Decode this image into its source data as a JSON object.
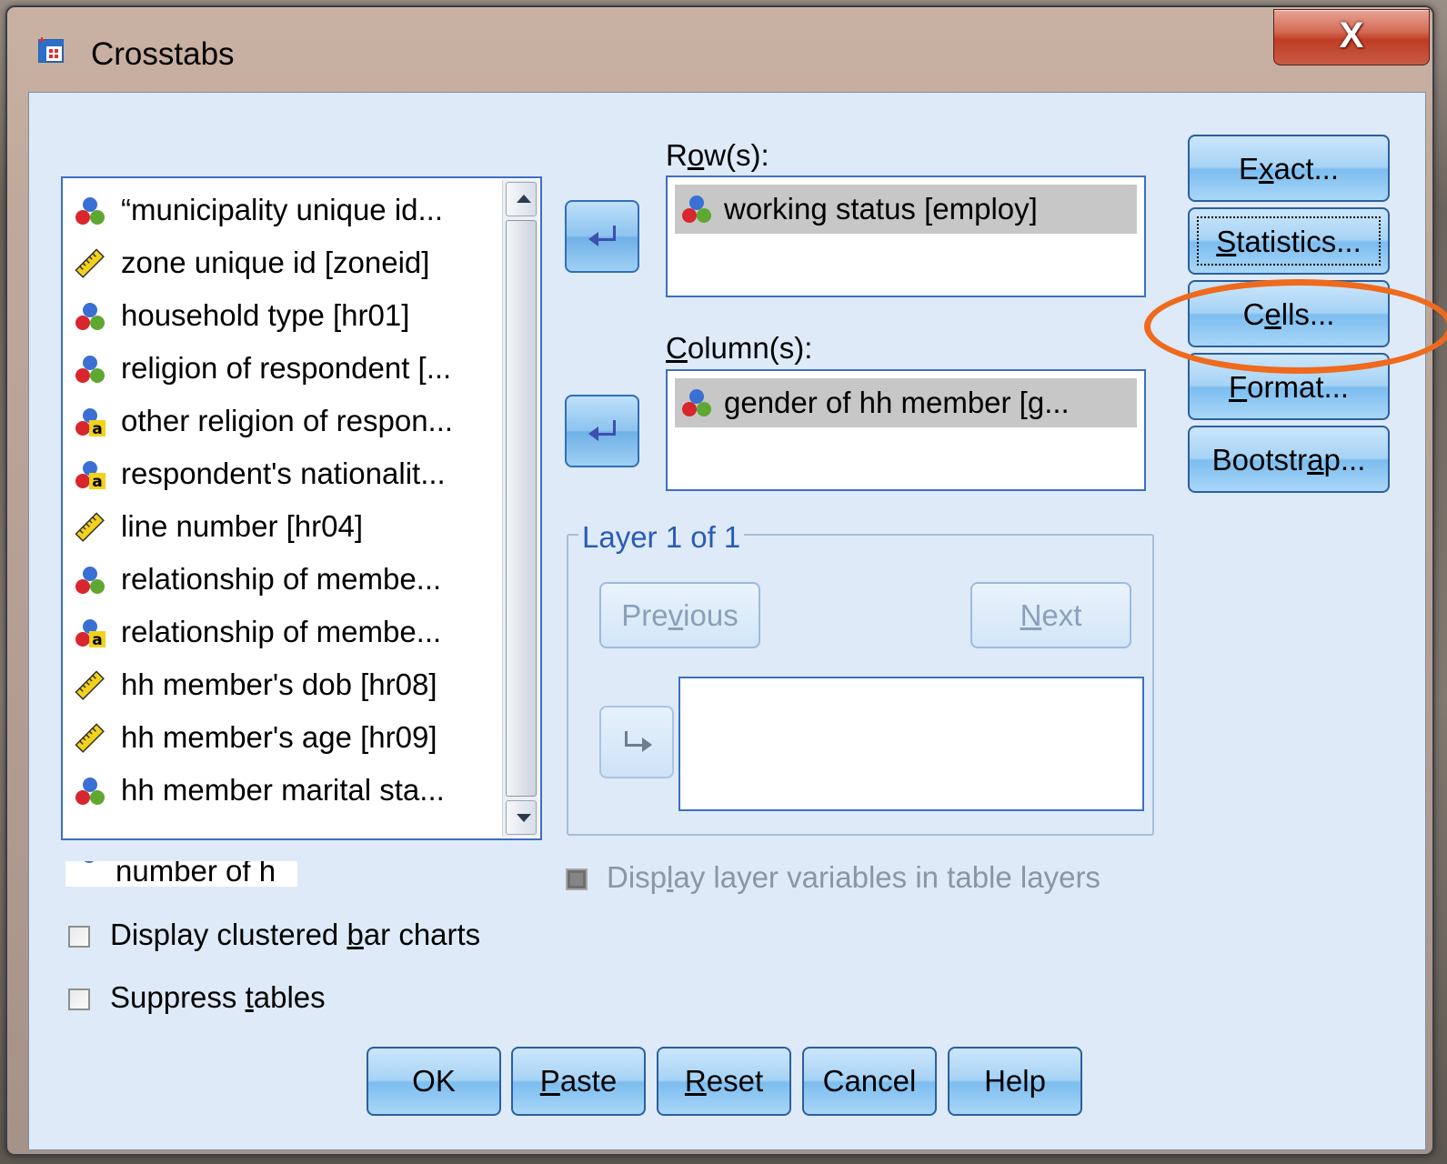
{
  "window": {
    "title": "Crosstabs",
    "close_label": "X"
  },
  "variables": {
    "items": [
      {
        "label": "“municipality unique id...",
        "icon": "nominal-icon"
      },
      {
        "label": "zone unique id [zoneid]",
        "icon": "scale-ruler-icon"
      },
      {
        "label": "household type [hr01]",
        "icon": "nominal-icon"
      },
      {
        "label": "religion of respondent [...",
        "icon": "nominal-icon"
      },
      {
        "label": "other religion of respon...",
        "icon": "string-nominal-icon"
      },
      {
        "label": "respondent's nationalit...",
        "icon": "string-nominal-icon"
      },
      {
        "label": "line number [hr04]",
        "icon": "scale-ruler-icon"
      },
      {
        "label": "relationship of membe...",
        "icon": "nominal-icon"
      },
      {
        "label": "relationship of membe...",
        "icon": "string-nominal-icon"
      },
      {
        "label": "hh member's dob [hr08]",
        "icon": "scale-ruler-icon"
      },
      {
        "label": "hh member's age [hr09]",
        "icon": "scale-ruler-icon"
      },
      {
        "label": "hh member marital sta...",
        "icon": "nominal-icon"
      }
    ],
    "cut_item_label": "number of h"
  },
  "rows": {
    "label_pre": "R",
    "label_u": "o",
    "label_post": "w(s):",
    "item": "working status [employ]"
  },
  "columns": {
    "label_pre": "",
    "label_u": "C",
    "label_post": "olumn(s):",
    "item": "gender of hh member [g..."
  },
  "layer": {
    "legend": "Layer 1 of 1",
    "previous_pre": "Pre",
    "previous_u": "v",
    "previous_post": "ious",
    "next_pre": "",
    "next_u": "N",
    "next_post": "ext",
    "display_layer_pre": "Disp",
    "display_layer_u": "l",
    "display_layer_post": "ay layer variables in table layers"
  },
  "side_buttons": {
    "exact_pre": "E",
    "exact_u": "x",
    "exact_post": "act...",
    "statistics_pre": "",
    "statistics_u": "S",
    "statistics_post": "tatistics...",
    "cells_pre": "C",
    "cells_u": "e",
    "cells_post": "lls...",
    "format_pre": "",
    "format_u": "F",
    "format_post": "ormat...",
    "bootstrap_pre": "Bootstr",
    "bootstrap_u": "a",
    "bootstrap_post": "p..."
  },
  "options": {
    "clustered_pre": "Display clustered ",
    "clustered_u": "b",
    "clustered_post": "ar charts",
    "clustered_checked": false,
    "suppress_pre": "Suppress ",
    "suppress_u": "t",
    "suppress_post": "ables",
    "suppress_checked": false
  },
  "footer": {
    "ok": "OK",
    "paste_u": "P",
    "paste_post": "aste",
    "reset_u": "R",
    "reset_post": "eset",
    "cancel": "Cancel",
    "help": "Help"
  },
  "colors": {
    "highlight_ring": "#ef6a1c",
    "client_bg": "#deeaf8",
    "selected_item_bg": "#c7c7c7"
  }
}
